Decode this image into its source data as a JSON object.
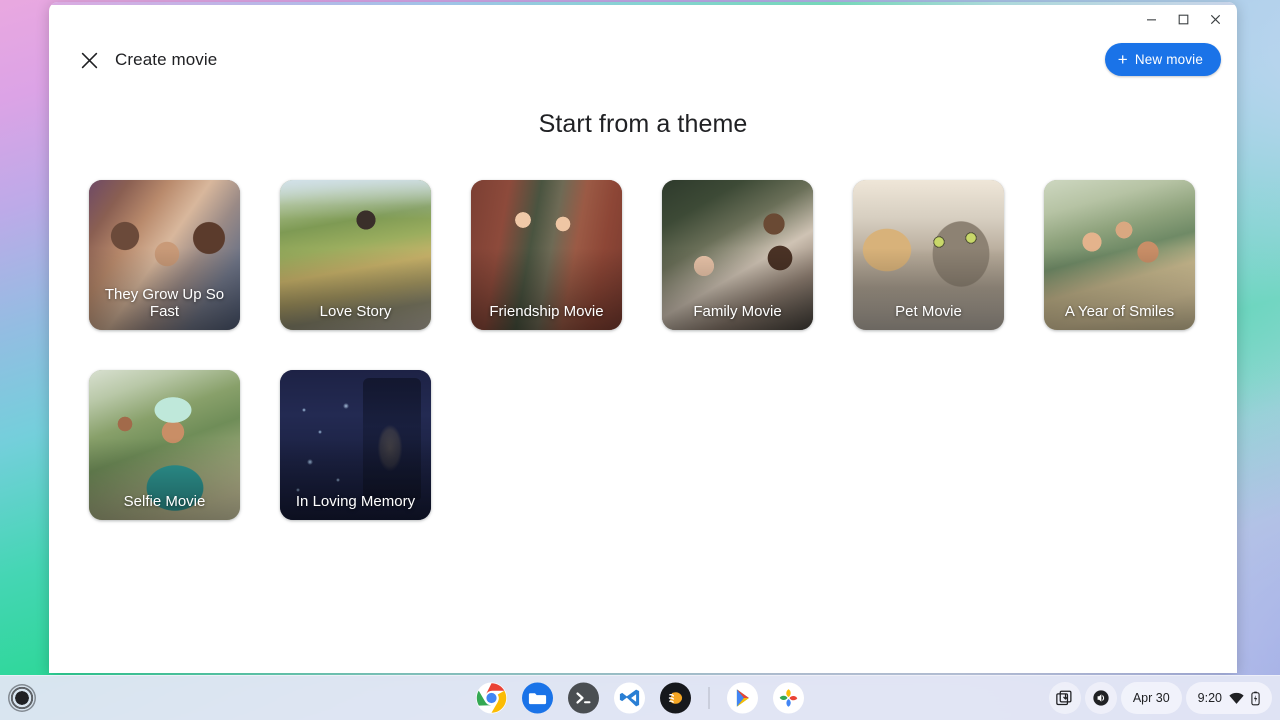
{
  "window": {
    "controls": {
      "minimize_label": "Minimize",
      "maximize_label": "Maximize",
      "close_label": "Close"
    }
  },
  "app_header": {
    "close_icon": "close-icon",
    "title": "Create movie",
    "new_movie": {
      "plus": "+",
      "label": "New movie",
      "color": "#1a73e8"
    }
  },
  "main": {
    "heading": "Start from a theme",
    "themes": [
      {
        "label": "They Grow Up So Fast",
        "art": "art-kids",
        "wrap": true
      },
      {
        "label": "Love Story",
        "art": "art-love",
        "wrap": false
      },
      {
        "label": "Friendship Movie",
        "art": "art-friend",
        "wrap": false
      },
      {
        "label": "Family Movie",
        "art": "art-family",
        "wrap": false
      },
      {
        "label": "Pet Movie",
        "art": "art-pet",
        "wrap": false
      },
      {
        "label": "A Year of Smiles",
        "art": "art-smiles",
        "wrap": false
      },
      {
        "label": "Selfie Movie",
        "art": "art-selfie",
        "wrap": false
      },
      {
        "label": "In Loving Memory",
        "art": "art-memory",
        "wrap": true
      }
    ]
  },
  "shelf": {
    "launcher_label": "Launcher",
    "apps": [
      {
        "name": "chrome",
        "label": "Google Chrome"
      },
      {
        "name": "files",
        "label": "Files"
      },
      {
        "name": "terminal",
        "label": "Terminal"
      },
      {
        "name": "vscode",
        "label": "Visual Studio Code"
      },
      {
        "name": "app-orange",
        "label": "App"
      },
      {
        "name": "play-store",
        "label": "Play Store"
      },
      {
        "name": "photos",
        "label": "Google Photos"
      }
    ],
    "status": {
      "screen_capture_icon": "screen-capture-icon",
      "volume_icon": "volume-mute-icon",
      "date": "Apr 30",
      "time": "9:20",
      "wifi_icon": "wifi-icon",
      "battery_icon": "battery-icon"
    }
  }
}
